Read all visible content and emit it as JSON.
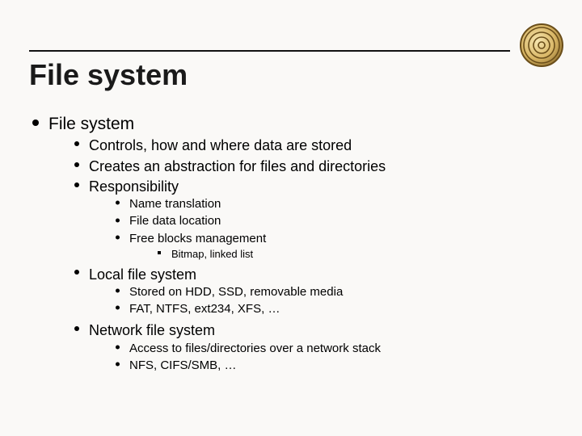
{
  "title": "File system",
  "decor": {
    "name": "snail-shell-icon"
  },
  "outline": {
    "heading": "File system",
    "items": [
      "Controls, how and where data are stored",
      "Creates an abstraction for files and directories",
      "Responsibility"
    ],
    "responsibility": {
      "items": [
        "Name translation",
        "File data location",
        "Free blocks management"
      ],
      "free_blocks_detail": "Bitmap, linked list"
    },
    "local": {
      "heading": "Local file system",
      "items": [
        "Stored on HDD, SSD, removable media",
        "FAT, NTFS, ext234, XFS, …"
      ]
    },
    "network": {
      "heading": "Network file system",
      "items": [
        "Access to files/directories over a network stack",
        "NFS, CIFS/SMB, …"
      ]
    }
  }
}
